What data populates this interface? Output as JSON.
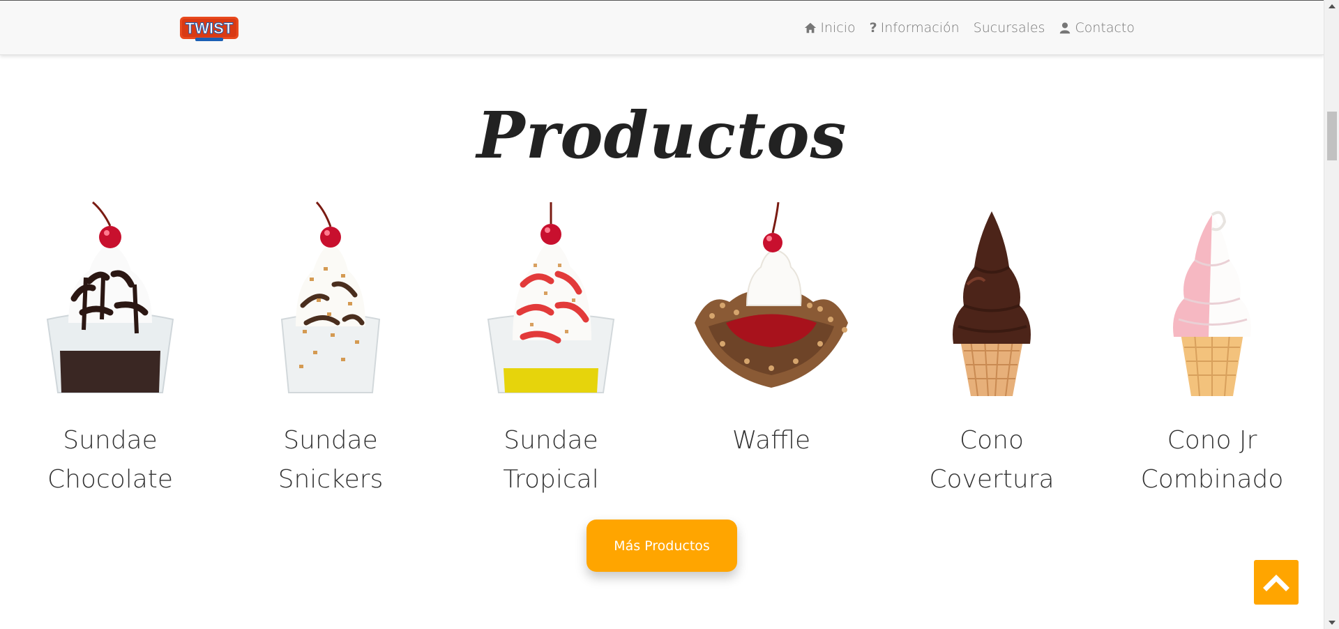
{
  "nav": {
    "brand": "TWIST",
    "items": [
      {
        "label": "Inicio",
        "icon": "home-icon"
      },
      {
        "label": "Información",
        "icon": "question-icon"
      },
      {
        "label": "Sucursales",
        "icon": ""
      },
      {
        "label": "Contacto",
        "icon": "user-icon"
      }
    ]
  },
  "section": {
    "title": "Productos"
  },
  "products": [
    {
      "name": "Sundae Chocolate",
      "image": "sundae-chocolate-image"
    },
    {
      "name": "Sundae Snickers",
      "image": "sundae-snickers-image"
    },
    {
      "name": "Sundae Tropical",
      "image": "sundae-tropical-image"
    },
    {
      "name": "Waffle",
      "image": "waffle-image"
    },
    {
      "name": "Cono Covertura",
      "image": "cono-covertura-image"
    },
    {
      "name": "Cono Jr Combinado",
      "image": "cono-jr-combinado-image"
    }
  ],
  "more_button": "Más Productos",
  "colors": {
    "accent": "#ffa500",
    "nav_text": "#777777",
    "navbar_bg": "#f8f8f8"
  }
}
